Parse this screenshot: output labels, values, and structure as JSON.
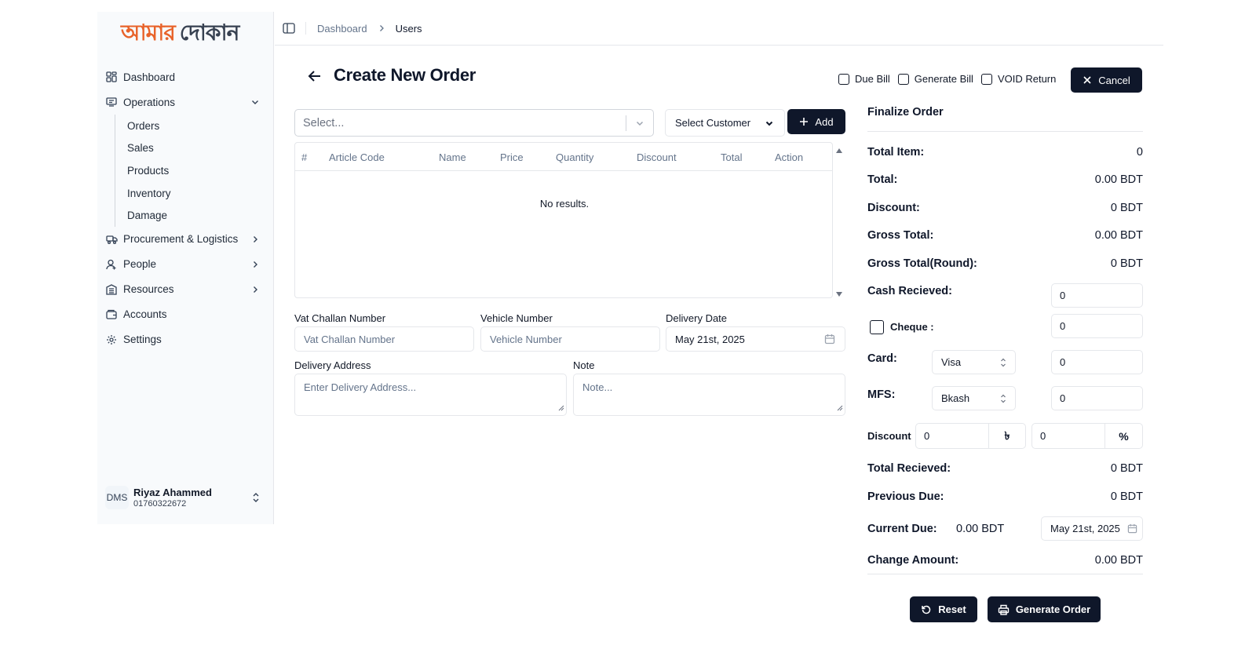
{
  "sidebar": {
    "logo_left": "আমার",
    "logo_right": "দোকান",
    "items": [
      {
        "label": "Dashboard",
        "icon": "grid-icon"
      },
      {
        "label": "Operations",
        "icon": "monitor-icon"
      },
      {
        "label": "Procurement & Logistics",
        "icon": "truck-icon"
      },
      {
        "label": "People",
        "icon": "user-icon"
      },
      {
        "label": "Resources",
        "icon": "building-icon"
      },
      {
        "label": "Accounts",
        "icon": "wallet-icon"
      },
      {
        "label": "Settings",
        "icon": "gear-icon"
      }
    ],
    "operations_sub": [
      "Orders",
      "Sales",
      "Products",
      "Inventory",
      "Damage"
    ],
    "user": {
      "avatar": "DMS",
      "name": "Riyaz Ahammed",
      "phone": "01760322672"
    }
  },
  "breadcrumb": {
    "parent": "Dashboard",
    "current": "Users"
  },
  "page": {
    "title": "Create New Order",
    "checks": [
      "Due Bill",
      "Generate Bill",
      "VOID Return"
    ],
    "cancel_label": "Cancel"
  },
  "product_select": {
    "placeholder": "Select..."
  },
  "customer_select": {
    "label": "Select Customer"
  },
  "add_label": "Add",
  "table": {
    "columns": [
      "#",
      "Article Code",
      "Name",
      "Price",
      "Quantity",
      "Discount",
      "Total",
      "Action"
    ],
    "empty_text": "No results."
  },
  "form": {
    "vat_label": "Vat Challan Number",
    "vat_placeholder": "Vat Challan Number",
    "vehicle_label": "Vehicle Number",
    "vehicle_placeholder": "Vehicle Number",
    "delivery_date_label": "Delivery Date",
    "delivery_date_value": "May 21st, 2025",
    "address_label": "Delivery Address",
    "address_placeholder": "Enter Delivery Address...",
    "note_label": "Note",
    "note_placeholder": "Note..."
  },
  "finalize": {
    "title": "Finalize Order",
    "total_item_label": "Total Item:",
    "total_item": "0",
    "total_label": "Total:",
    "total": "0.00 BDT",
    "discount_label": "Discount:",
    "discount": "0 BDT",
    "gross_label": "Gross Total:",
    "gross": "0.00 BDT",
    "gross_round_label": "Gross Total(Round):",
    "gross_round": "0 BDT",
    "cash_label": "Cash Recieved:",
    "cash_value": "0",
    "cheque_label": "Cheque :",
    "cheque_value": "0",
    "card_label": "Card:",
    "card_type": "Visa",
    "card_value": "0",
    "mfs_label": "MFS:",
    "mfs_type": "Bkash",
    "mfs_value": "0",
    "disc_label": "Discount",
    "disc_amount": "0",
    "disc_amount_unit": "৳",
    "disc_percent": "0",
    "disc_percent_unit": "%",
    "total_recv_label": "Total Recieved:",
    "total_recv": "0 BDT",
    "prev_due_label": "Previous Due:",
    "prev_due": "0 BDT",
    "cur_due_label": "Current Due:",
    "cur_due": "0.00 BDT",
    "cur_due_date": "May 21st, 2025",
    "change_label": "Change Amount:",
    "change": "0.00 BDT"
  },
  "actions": {
    "reset_label": "Reset",
    "generate_label": "Generate Order"
  },
  "colors": {
    "accent_dark": "#0f172a",
    "logo_orange": "#e8632a"
  }
}
